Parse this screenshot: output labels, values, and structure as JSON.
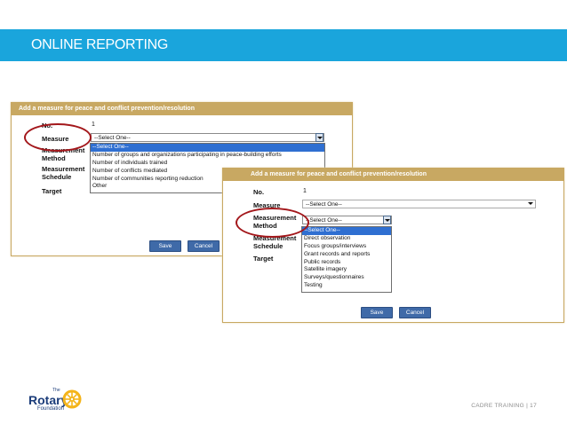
{
  "slide": {
    "title": "ONLINE REPORTING",
    "footer": "CADRE TRAINING | 17"
  },
  "logo": {
    "the": "The",
    "name": "Rotary",
    "sub": "Foundation"
  },
  "form_back": {
    "header": "Add a measure for peace and conflict prevention/resolution",
    "no_label": "No.",
    "no_value": "1",
    "measure_label": "Measure",
    "measurement_method_label": "Measurement Method",
    "measurement_schedule_label": "Measurement Schedule",
    "target_label": "Target",
    "measure_select": "--Select One--",
    "measure_options": [
      "--Select One--",
      "Number of groups and organizations participating in peace-building efforts",
      "Number of individuals trained",
      "Number of conflicts mediated",
      "Number of communities reporting reduction",
      "Other"
    ],
    "save": "Save",
    "cancel": "Cancel"
  },
  "form_front": {
    "header": "Add a measure for peace and conflict prevention/resolution",
    "no_label": "No.",
    "no_value": "1",
    "measure_label": "Measure",
    "measure_select": "--Select One--",
    "measurement_method_label": "Measurement Method",
    "measurement_schedule_label": "Measurement Schedule",
    "target_label": "Target",
    "method_select": "--Select One--",
    "method_options": [
      "--Select One--",
      "Direct observation",
      "Focus groups/interviews",
      "Grant records and reports",
      "Public records",
      "Satellite imagery",
      "Surveys/questionnaires",
      "Testing"
    ],
    "save": "Save",
    "cancel": "Cancel"
  },
  "colors": {
    "banner": "#1aa5dc",
    "panel_header": "#c8a862",
    "highlight": "#2f6fd1",
    "button": "#3f6aa8",
    "ellipse": "#a3171b"
  }
}
